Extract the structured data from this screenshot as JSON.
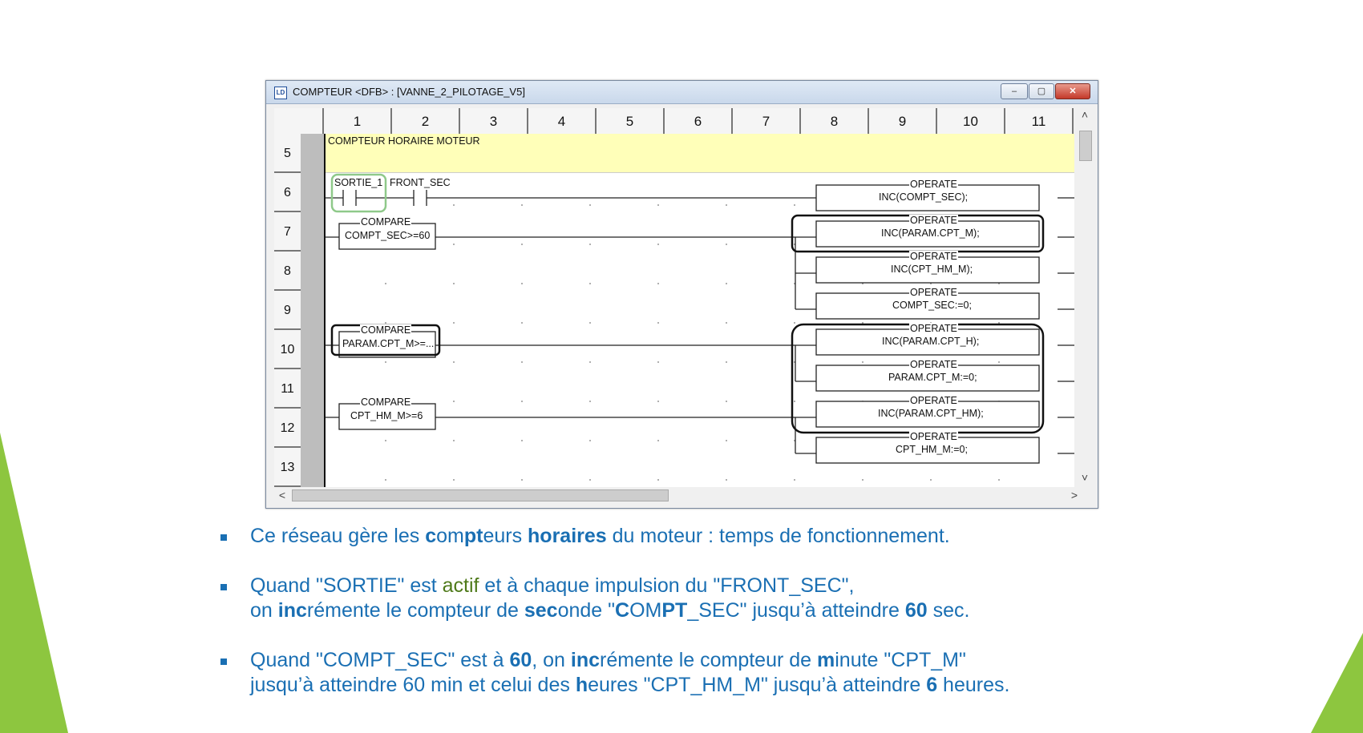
{
  "window": {
    "title": "COMPTEUR <DFB> : [VANNE_2_PILOTAGE_V5]",
    "min_glyph": "‒",
    "max_glyph": "▢",
    "close_glyph": "✕",
    "scroll_up": "˄",
    "scroll_down": "˅",
    "scroll_left": "<",
    "scroll_right": ">"
  },
  "ladder": {
    "columns": [
      "1",
      "2",
      "3",
      "4",
      "5",
      "6",
      "7",
      "8",
      "9",
      "10",
      "11"
    ],
    "rows": [
      "5",
      "6",
      "7",
      "8",
      "9",
      "10",
      "11",
      "12",
      "13"
    ],
    "comment": "COMPTEUR HORAIRE MOTEUR",
    "contacts": [
      "SORTIE_1",
      "FRONT_SEC"
    ],
    "compare_blocks": [
      {
        "title": "COMPARE",
        "expr": "COMPT_SEC>=60"
      },
      {
        "title": "COMPARE",
        "expr": "PARAM.CPT_M>=..."
      },
      {
        "title": "COMPARE",
        "expr": "CPT_HM_M>=6"
      }
    ],
    "operate_blocks": [
      {
        "title": "OPERATE",
        "expr": "INC(COMPT_SEC);"
      },
      {
        "title": "OPERATE",
        "expr": "INC(PARAM.CPT_M);"
      },
      {
        "title": "OPERATE",
        "expr": "INC(CPT_HM_M);"
      },
      {
        "title": "OPERATE",
        "expr": "COMPT_SEC:=0;"
      },
      {
        "title": "OPERATE",
        "expr": "INC(PARAM.CPT_H);"
      },
      {
        "title": "OPERATE",
        "expr": "PARAM.CPT_M:=0;"
      },
      {
        "title": "OPERATE",
        "expr": "INC(PARAM.CPT_HM);"
      },
      {
        "title": "OPERATE",
        "expr": "CPT_HM_M:=0;"
      }
    ]
  },
  "bullets": {
    "b1": {
      "p1": "Ce réseau gère les ",
      "b1": "c",
      "p2": "om",
      "b2": "pt",
      "p3": "eurs ",
      "b3": "horaires",
      "p4": " du moteur : temps de fonctionnement."
    },
    "b2": {
      "p1": "Quand \"SORTIE\" est ",
      "g1": "actif",
      "p2": " et à chaque impulsion du \"FRONT_SEC\",",
      "p3": "on ",
      "b1": "inc",
      "p4": "rémente le compteur de ",
      "b2": "sec",
      "p5": "onde \"",
      "b3": "C",
      "p6": "OM",
      "b4": "PT",
      "p7": "_SEC\" jusqu’à atteindre ",
      "b5": "60",
      "p8": " sec."
    },
    "b3": {
      "p1": "Quand \"COMPT_SEC\" est à ",
      "b1": "60",
      "p2": ", on ",
      "b2": "inc",
      "p3": "rémente le compteur de ",
      "b3": "m",
      "p4": "inute \"CPT_M\"",
      "p5": "jusqu’à atteindre 60 min et celui des ",
      "b4": "h",
      "p6": "eures \"CPT_HM_M\" jusqu’à atteindre ",
      "b5": "6",
      "p7": " heures."
    }
  },
  "colors": {
    "accent_green": "#8dc63f",
    "text_blue": "#1a6fb3",
    "comment_yellow": "#ffffb9"
  }
}
